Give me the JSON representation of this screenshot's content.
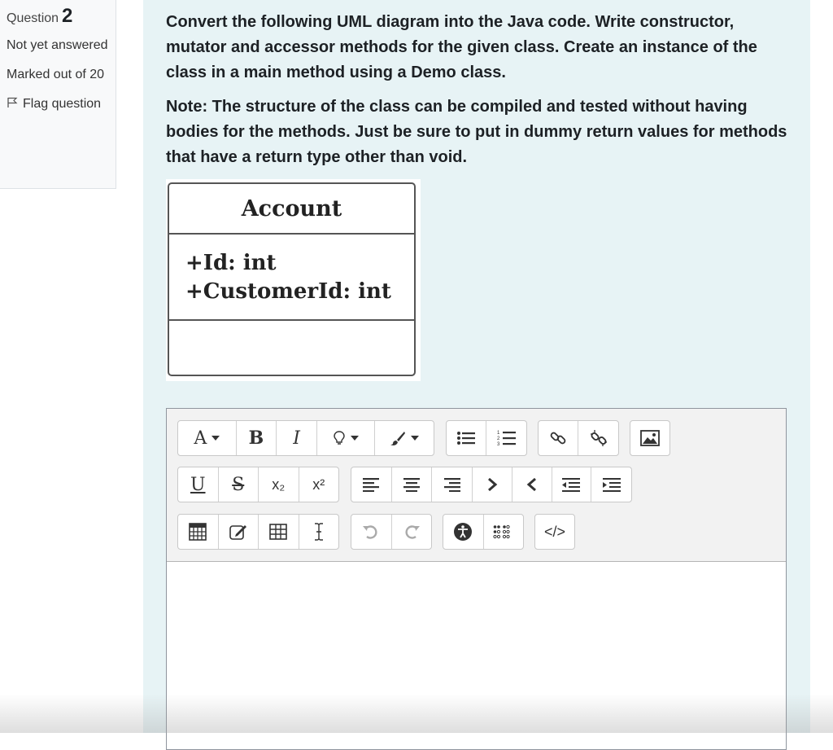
{
  "info": {
    "question_label": "Question",
    "question_number": "2",
    "state": "Not yet answered",
    "grade": "Marked out of 20",
    "flag_label": "Flag question"
  },
  "question": {
    "paragraph1": "Convert the following UML diagram into the Java code. Write constructor, mutator and accessor methods for the given class. Create an instance of the class in a main method using a Demo class.",
    "paragraph2": "Note: The structure of the class can be compiled and tested without having bodies for the methods. Just be sure to put in dummy return values for methods that have a return type other than void."
  },
  "uml": {
    "class_name": "Account",
    "attributes": [
      "+Id: int",
      "+CustomerId: int"
    ]
  },
  "editor": {
    "font_btn": "A",
    "bold_btn": "B",
    "italic_btn": "I",
    "underline_btn": "U",
    "strike_btn": "S",
    "subscript_btn": "x₂",
    "superscript_btn": "x²",
    "html_btn": "</>",
    "content": ""
  },
  "colors": {
    "content_bg": "#e7f3f5",
    "panel_bg": "#f8f9fa",
    "toolbar_bg": "#f2f2f2"
  }
}
